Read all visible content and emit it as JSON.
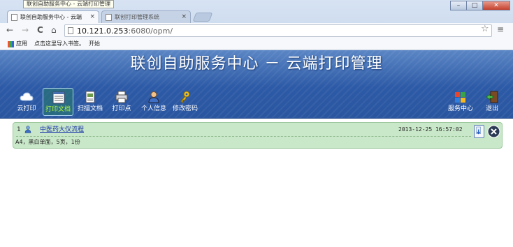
{
  "browser": {
    "tooltip": "联创自助服务中心 - 云端打印管理",
    "tabs": [
      {
        "label": "联创自助服务中心 - 云端",
        "active": true
      },
      {
        "label": "联创打印管理系统",
        "active": false
      }
    ],
    "tab_close_glyph": "×",
    "window_buttons": {
      "minimize": "–",
      "maximize": "□",
      "close": "✕"
    },
    "nav": {
      "back": "←",
      "forward": "→",
      "reload": "C",
      "home": "⌂"
    },
    "url": {
      "host": "10.121.0.253",
      "path": ":6080/opm/"
    },
    "star_glyph": "☆",
    "menu_glyph": "≡",
    "bookmarks": [
      "应用",
      "点击这里导入书签。",
      "开始"
    ]
  },
  "app": {
    "title": "联创自助服务中心 － 云端打印管理",
    "nav_left": [
      {
        "label": "云打印",
        "icon": "cloud-icon",
        "active": false
      },
      {
        "label": "打印文档",
        "icon": "document-list-icon",
        "active": true
      },
      {
        "label": "扫描文档",
        "icon": "scan-document-icon",
        "active": false
      },
      {
        "label": "打印点",
        "icon": "printer-icon",
        "active": false
      },
      {
        "label": "个人信息",
        "icon": "user-icon",
        "active": false
      },
      {
        "label": "修改密码",
        "icon": "key-icon",
        "active": false
      }
    ],
    "nav_right": [
      {
        "label": "服务中心",
        "icon": "service-center-icon"
      },
      {
        "label": "退出",
        "icon": "exit-door-icon"
      }
    ]
  },
  "jobs": [
    {
      "index": "1",
      "name": "中医药大仪流程",
      "time": "2013-12-25 16:57:02",
      "detail": "A4，黑白单面，5页，1份"
    }
  ],
  "colors": {
    "header_top": "#5b86c5",
    "header_bottom": "#2a56a0",
    "job_bg": "#c9e8c9",
    "active_label": "#b5ff3a",
    "link": "#1530a8"
  }
}
